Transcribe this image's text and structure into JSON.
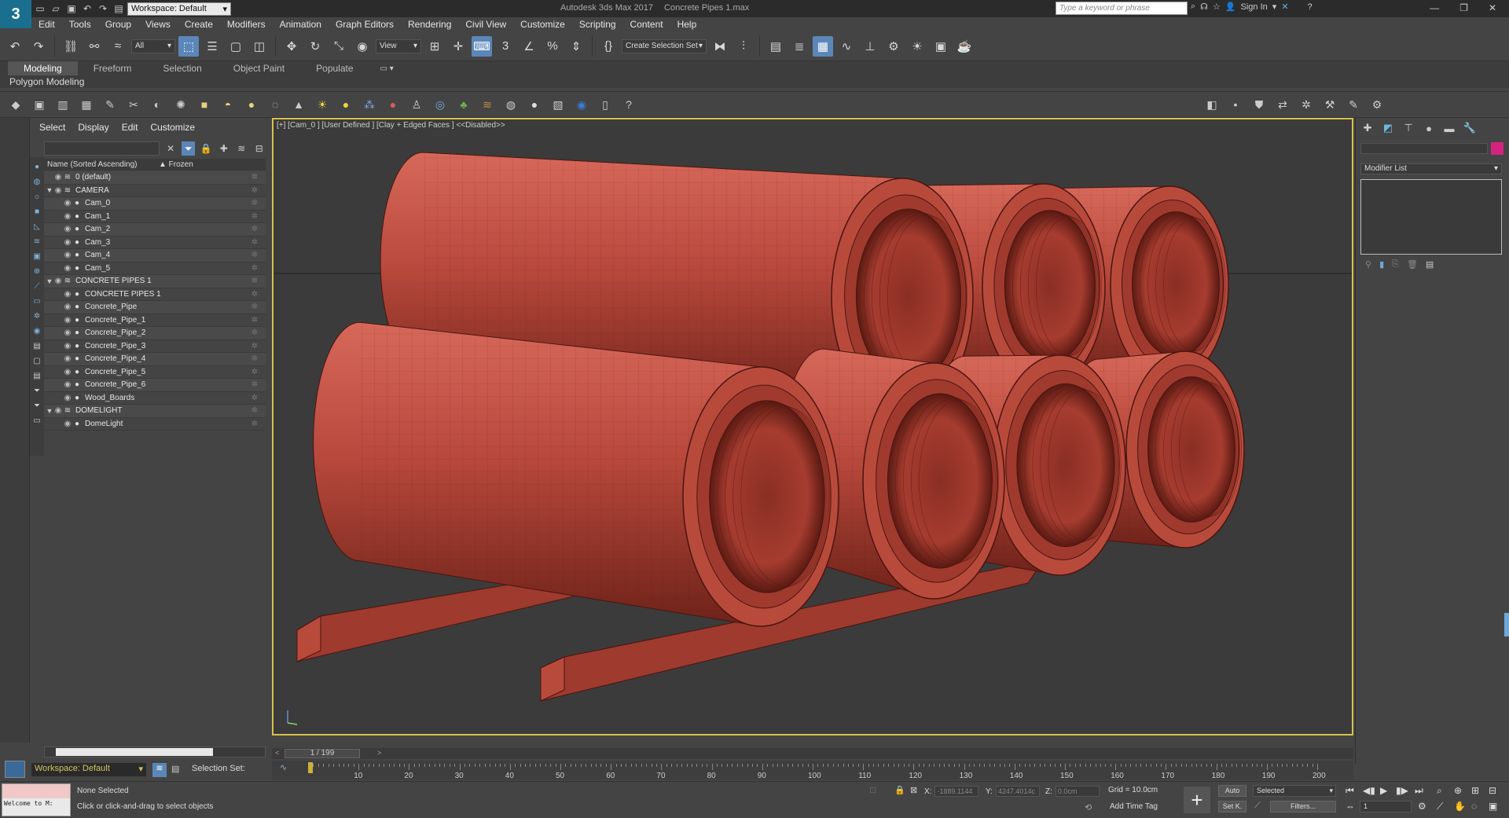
{
  "titlebar": {
    "logo": "3",
    "workspace": "Workspace: Default",
    "app_name": "Autodesk 3ds Max 2017",
    "file_name": "Concrete Pipes 1.max",
    "search_placeholder": "Type a keyword or phrase",
    "sign_in": "Sign In"
  },
  "menubar": [
    "Edit",
    "Tools",
    "Group",
    "Views",
    "Create",
    "Modifiers",
    "Animation",
    "Graph Editors",
    "Rendering",
    "Civil View",
    "Customize",
    "Scripting",
    "Content",
    "Help"
  ],
  "maintoolbar": {
    "filter_all": "All",
    "ref_coord": "View",
    "selection_set_dd": "Create Selection Set"
  },
  "ribbon": {
    "tabs": [
      "Modeling",
      "Freeform",
      "Selection",
      "Object Paint",
      "Populate"
    ],
    "active_tab": "Modeling",
    "sub_label": "Polygon Modeling"
  },
  "explorer": {
    "menu": [
      "Select",
      "Display",
      "Edit",
      "Customize"
    ],
    "col_name": "Name (Sorted Ascending)",
    "col_frozen": "▲ Frozen",
    "rows": [
      {
        "label": "0 (default)",
        "level": 0,
        "expand": ""
      },
      {
        "label": "CAMERA",
        "level": 0,
        "expand": "▼"
      },
      {
        "label": "Cam_0",
        "level": 1,
        "expand": ""
      },
      {
        "label": "Cam_1",
        "level": 1,
        "expand": ""
      },
      {
        "label": "Cam_2",
        "level": 1,
        "expand": ""
      },
      {
        "label": "Cam_3",
        "level": 1,
        "expand": ""
      },
      {
        "label": "Cam_4",
        "level": 1,
        "expand": ""
      },
      {
        "label": "Cam_5",
        "level": 1,
        "expand": ""
      },
      {
        "label": "CONCRETE PIPES 1",
        "level": 0,
        "expand": "▼"
      },
      {
        "label": "CONCRETE PIPES 1",
        "level": 1,
        "expand": ""
      },
      {
        "label": "Concrete_Pipe",
        "level": 1,
        "expand": ""
      },
      {
        "label": "Concrete_Pipe_1",
        "level": 1,
        "expand": ""
      },
      {
        "label": "Concrete_Pipe_2",
        "level": 1,
        "expand": ""
      },
      {
        "label": "Concrete_Pipe_3",
        "level": 1,
        "expand": ""
      },
      {
        "label": "Concrete_Pipe_4",
        "level": 1,
        "expand": ""
      },
      {
        "label": "Concrete_Pipe_5",
        "level": 1,
        "expand": ""
      },
      {
        "label": "Concrete_Pipe_6",
        "level": 1,
        "expand": ""
      },
      {
        "label": "Wood_Boards",
        "level": 1,
        "expand": ""
      },
      {
        "label": "DOMELIGHT",
        "level": 0,
        "expand": "▼"
      },
      {
        "label": "DomeLight",
        "level": 1,
        "expand": ""
      }
    ]
  },
  "viewport": {
    "label": "[+] [Cam_0 ] [User Defined ] [Clay + Edged Faces ]  <<Disabled>>",
    "pipe_color": "#b8483c",
    "border_color": "#d8c24a"
  },
  "command_panel": {
    "modifier_list": "Modifier List",
    "object_color": "#d4237e"
  },
  "timeline": {
    "frame": "1 / 199",
    "ticks": [
      "10",
      "20",
      "30",
      "40",
      "50",
      "60",
      "70",
      "80",
      "90",
      "100",
      "110",
      "120",
      "130",
      "140",
      "150",
      "160",
      "170",
      "180",
      "190",
      "200"
    ]
  },
  "bottom": {
    "workspace": "Workspace: Default",
    "selection_set": "Selection Set:"
  },
  "status": {
    "maxscript": "Welcome to M:",
    "selection": "None Selected",
    "prompt": "Click or click-and-drag to select objects",
    "x_label": "X:",
    "x_value": "-1889.1144",
    "y_label": "Y:",
    "y_value": "4247.4014c",
    "z_label": "Z:",
    "z_value": "0.0cm",
    "grid": "Grid = 10.0cm",
    "add_time_tag": "Add Time Tag",
    "auto": "Auto",
    "set_key": "Set K.",
    "selected_dd": "Selected",
    "filters": "Filters...",
    "frame_field": "1"
  }
}
